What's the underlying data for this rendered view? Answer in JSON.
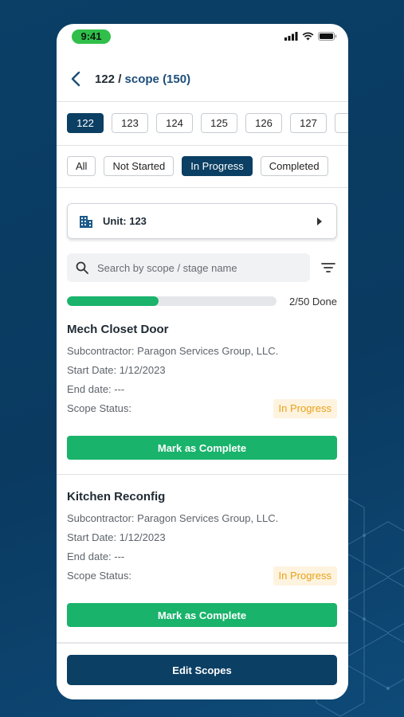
{
  "status_bar": {
    "time": "9:41"
  },
  "header": {
    "title_prefix": "122 /",
    "title_scope": "scope (150)"
  },
  "units": [
    "122",
    "123",
    "124",
    "125",
    "126",
    "127",
    "1"
  ],
  "filters": [
    "All",
    "Not Started",
    "In Progress",
    "Completed"
  ],
  "unit_selector": {
    "label": "Unit: 123"
  },
  "search": {
    "placeholder": "Search by scope / stage name",
    "value": ""
  },
  "progress": {
    "done": 2,
    "total": 50,
    "text": "2/50 Done"
  },
  "scopes": [
    {
      "title": "Mech Closet Door",
      "subcontractor": "Subcontractor: Paragon Services Group, LLC.",
      "start_date": "Start Date: 1/12/2023",
      "end_date": "End date: ---",
      "status_label": "Scope Status:",
      "status": "In Progress",
      "button": "Mark as Complete"
    },
    {
      "title": "Kitchen Reconfig",
      "subcontractor": "Subcontractor: Paragon Services Group, LLC.",
      "start_date": "Start Date: 1/12/2023",
      "end_date": "End date: ---",
      "status_label": "Scope Status:",
      "status": "In Progress",
      "button": "Mark as Complete"
    }
  ],
  "footer": {
    "button": "Edit Scopes"
  },
  "colors": {
    "primary": "#0b3f63",
    "success": "#19b36b",
    "warning_text": "#e8a21a",
    "warning_bg": "#fdf3df"
  },
  "icons": [
    "back-chevron-icon",
    "building-icon",
    "caret-right-icon",
    "search-icon",
    "filter-icon",
    "signal-icon",
    "wifi-icon",
    "battery-icon"
  ]
}
